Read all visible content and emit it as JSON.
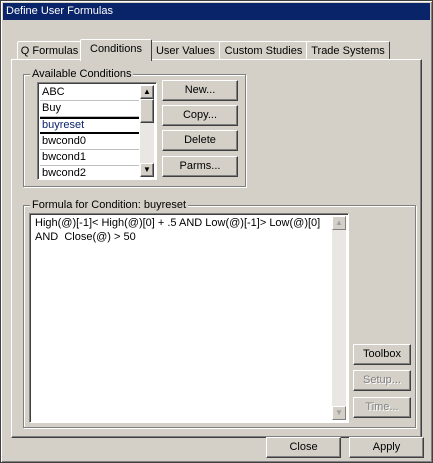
{
  "window": {
    "title": "Define User Formulas"
  },
  "tabs": [
    {
      "label": "Q Formulas"
    },
    {
      "label": "Conditions"
    },
    {
      "label": "User Values"
    },
    {
      "label": "Custom Studies"
    },
    {
      "label": "Trade Systems"
    }
  ],
  "active_tab": "Conditions",
  "available_conditions": {
    "title": "Available Conditions",
    "items": [
      "ABC",
      "Buy",
      "buyreset",
      "bwcond0",
      "bwcond1",
      "bwcond2"
    ],
    "selected": "buyreset",
    "buttons": {
      "new": "New...",
      "copy": "Copy...",
      "delete": "Delete",
      "parms": "Parms..."
    }
  },
  "formula": {
    "title": "Formula for Condition: buyreset",
    "text": "High(@)[-1]< High(@)[0] + .5 AND Low(@)[-1]> Low(@)[0]\nAND  Close(@) > 50",
    "side_buttons": {
      "toolbox": "Toolbox",
      "setup": "Setup...",
      "time": "Time..."
    }
  },
  "footer": {
    "close": "Close",
    "apply": "Apply"
  },
  "icons": {
    "scroll_up": "arrow-up-icon",
    "scroll_down": "arrow-down-icon"
  }
}
